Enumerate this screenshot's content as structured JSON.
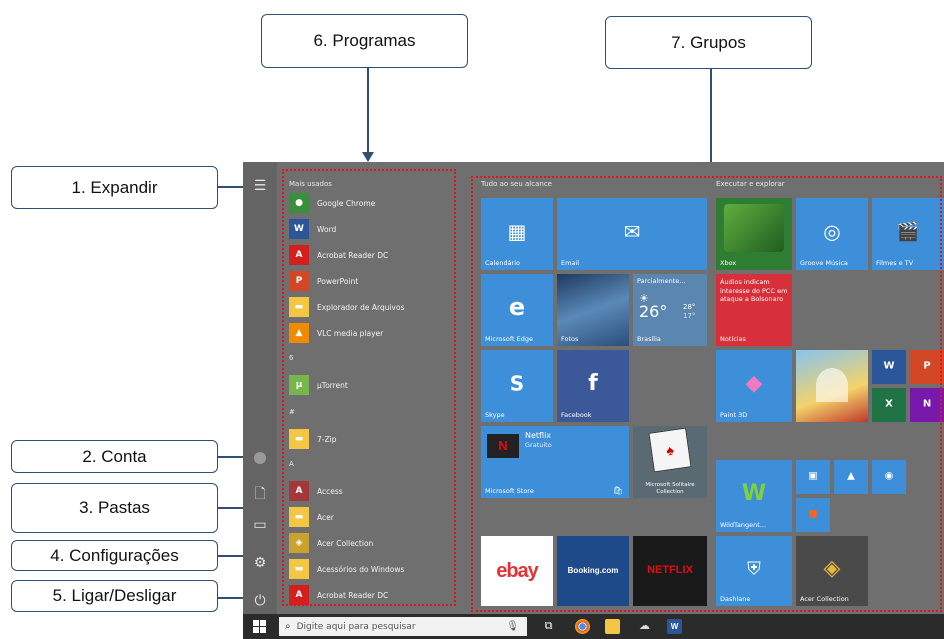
{
  "callouts": {
    "expandir": "1. Expandir",
    "conta": "2. Conta",
    "pastas": "3. Pastas",
    "configuracoes": "4. Configurações",
    "ligar": "5. Ligar/Desligar",
    "programas": "6. Programas",
    "grupos": "7. Grupos"
  },
  "applist": {
    "mais_usados": "Mais usados",
    "section_hash": "#",
    "section_7": "#",
    "section_a": "A",
    "section_u": "6",
    "apps": [
      {
        "label": "Google Chrome",
        "icon": "chrome-icon",
        "color": "#3a8f3a"
      },
      {
        "label": "Word",
        "icon": "word-icon",
        "color": "#2b579a"
      },
      {
        "label": "Acrobat Reader DC",
        "icon": "acrobat-icon",
        "color": "#d4201d"
      },
      {
        "label": "PowerPoint",
        "icon": "powerpoint-icon",
        "color": "#d24726"
      },
      {
        "label": "Explorador de Arquivos",
        "icon": "folder-icon",
        "color": "#f3c744"
      },
      {
        "label": "VLC media player",
        "icon": "vlc-icon",
        "color": "#f08a00"
      },
      {
        "label": "µTorrent",
        "icon": "utorrent-icon",
        "color": "#78b54b"
      },
      {
        "label": "7-Zip",
        "icon": "folder-icon",
        "color": "#f3c744"
      },
      {
        "label": "Access",
        "icon": "access-icon",
        "color": "#a4373a"
      },
      {
        "label": "Acer",
        "icon": "folder-icon",
        "color": "#f3c744"
      },
      {
        "label": "Acer Collection",
        "icon": "acer-collection-icon",
        "color": "#c9a230"
      },
      {
        "label": "Acessórios do Windows",
        "icon": "folder-icon",
        "color": "#f3c744"
      },
      {
        "label": "Acrobat Reader DC",
        "icon": "acrobat-icon",
        "color": "#d4201d"
      }
    ]
  },
  "groups": {
    "g1_title": "Tudo ao seu alcance",
    "g2_title": "Executar e explorar",
    "tiles": {
      "calendario": "Calendário",
      "email": "Email",
      "edge": "Microsoft Edge",
      "fotos": "Fotos",
      "weather_cond": "Parcialmente...",
      "weather_temp": "26°",
      "weather_hi": "28°",
      "weather_lo": "17°",
      "weather_city": "Brasília",
      "skype": "Skype",
      "facebook": "Facebook",
      "netflix_name": "Netflix",
      "netflix_sub": "Gratuito",
      "store": "Microsoft Store",
      "solitaire": "Microsoft Solitaire Collection",
      "xbox": "Xbox",
      "groove": "Groove Música",
      "filmes": "Filmes e TV",
      "news_text": "Áudios indicam interesse do PCC em ataque a Bolsonaro",
      "news_label": "Notícias",
      "paint3d": "Paint 3D",
      "wildtangent": "WildTangent...",
      "ebay": "ebay",
      "booking": "Booking.com",
      "netflix_logo": "NETFLIX",
      "dashlane": "Dashlane",
      "acer_collection": "Acer Collection"
    }
  },
  "taskbar": {
    "search_placeholder": "Digite aqui para pesquisar"
  },
  "colors": {
    "callout_border": "#2f4f73",
    "highlight": "#e0141a",
    "tile_blue": "#3d8fd9",
    "menu_bg": "#6f6f6f"
  }
}
